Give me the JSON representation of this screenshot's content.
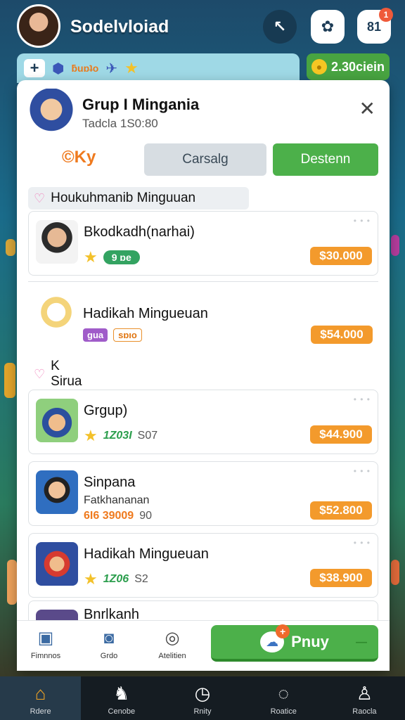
{
  "header": {
    "username": "Sodelvloiad",
    "notif_label": "81",
    "notif_badge": "1"
  },
  "subbar": {
    "text": "ƃuɒʇo",
    "coins": "2.30ciein"
  },
  "panel": {
    "title": "Grup I Mingania",
    "subtitle": "Tadcla 1S0:80",
    "close": "✕",
    "tabs": {
      "ok_label": "©Ky",
      "cancel_label": "Carsalg",
      "primary_label": "Destenn"
    },
    "sections": [
      {
        "label": "Houkuhmanib Minguuan"
      },
      {
        "label": "K Sirua"
      }
    ],
    "items": [
      {
        "name": "Bkodkadh(narhai)",
        "pill": "9 ɒe",
        "price": "$30.000"
      },
      {
        "name": "Hadikah Mingueuan",
        "pill_a": "gua",
        "pill_b": "sɒıo",
        "price": "$54.000"
      },
      {
        "name": "Grgup)",
        "num": "1Z03I",
        "num2": "S07",
        "price": "$44.900"
      },
      {
        "name": "Sinpana",
        "desc": "Fatkhananan",
        "num": "6I6 39009",
        "num2": "90",
        "price": "$52.800"
      },
      {
        "name": "Hadikah Mingueuan",
        "num": "1Z06",
        "num2": "S2",
        "price": "$38.900"
      },
      {
        "name": "Bnrlkanh"
      }
    ]
  },
  "actions": {
    "items": [
      {
        "label": "Fimnnos",
        "icon": "box-icon"
      },
      {
        "label": "Grdo",
        "icon": "camera-icon"
      },
      {
        "label": "Atelitien",
        "icon": "ring-icon"
      }
    ],
    "play_label": "Pnuy",
    "play_badge": "+",
    "play_dash": "—"
  },
  "bottom_nav": [
    {
      "label": "Rdere",
      "icon": "home-icon",
      "active": true
    },
    {
      "label": "Cenobe",
      "icon": "squid-icon"
    },
    {
      "label": "Rnity",
      "icon": "clock-icon"
    },
    {
      "label": "Roatice",
      "icon": "chat-icon"
    },
    {
      "label": "Raocla",
      "icon": "user-icon"
    }
  ],
  "colors": {
    "accent_green": "#4cb04a",
    "price_orange": "#f39a2c",
    "nav_bg": "#151c22"
  }
}
